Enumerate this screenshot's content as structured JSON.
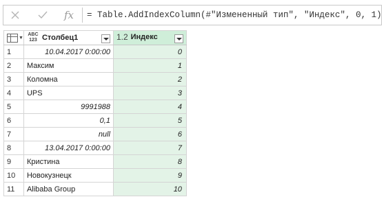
{
  "formula_bar": {
    "formula": "= Table.AddIndexColumn(#\"Измененный тип\", \"Индекс\", 0, 1)",
    "fx_label": "fx"
  },
  "table": {
    "columns": [
      {
        "label": "Столбец1",
        "type_icon": "abc-123-type-icon",
        "type_top": "ABC",
        "type_bottom": "123"
      },
      {
        "label": "Индекс",
        "type_icon": "decimal-type-icon",
        "type_text": "1.2"
      }
    ],
    "rows": [
      {
        "n": "1",
        "a": "10.04.2017 0:00:00",
        "b": "0"
      },
      {
        "n": "2",
        "a": "Максим",
        "b": "1"
      },
      {
        "n": "3",
        "a": "Коломна",
        "b": "2"
      },
      {
        "n": "4",
        "a": "UPS",
        "b": "3"
      },
      {
        "n": "5",
        "a": "9991988",
        "b": "4"
      },
      {
        "n": "6",
        "a": "0,1",
        "b": "5"
      },
      {
        "n": "7",
        "a": "null",
        "b": "6"
      },
      {
        "n": "8",
        "a": "13.04.2017 0:00:00",
        "b": "7"
      },
      {
        "n": "9",
        "a": "Кристина",
        "b": "8"
      },
      {
        "n": "10",
        "a": "Новокузнецк",
        "b": "9"
      },
      {
        "n": "11",
        "a": "Alibaba Group",
        "b": "10"
      }
    ]
  },
  "colors": {
    "index_column_bg": "#e3f3e7",
    "index_header_bg": "#cfeed9"
  }
}
